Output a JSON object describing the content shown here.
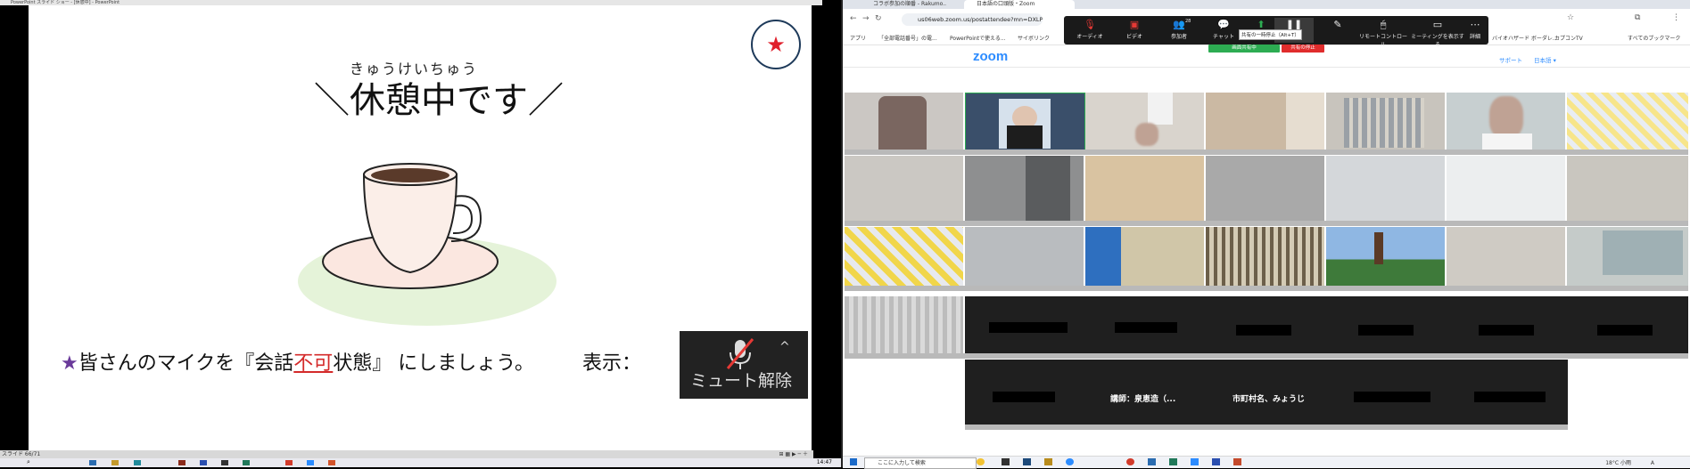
{
  "ppt": {
    "title_bar": "PowerPoint スライド ショー - [休憩中] - PowerPoint",
    "slide": {
      "ruby": "きゅうけいちゅう",
      "title": "＼休憩中です／",
      "star_badge": "★",
      "instruction_star": "★",
      "instruction_pre": "皆さんのマイクを『会話",
      "instruction_red": "不可",
      "instruction_post": "状態』 にしましょう。",
      "display_label": "表示：",
      "mute_button_label": "ミュート解除",
      "mute_caret": "^"
    },
    "status_bar": {
      "slide_number": "スライド 66/71",
      "time": "14:47"
    }
  },
  "chrome": {
    "tabs": [
      {
        "label": "コラボ参加の順番 - Rakumo.."
      },
      {
        "label": "日本語の口頭版・Zoom"
      }
    ],
    "url": "us06web.zoom.us/postattendee?mn=DXLP...",
    "bookmarks": [
      {
        "label": "アプリ"
      },
      {
        "label": "「全部電話番号」の電..."
      },
      {
        "label": "PowerPointで使える..."
      },
      {
        "label": "サイボリンク"
      },
      {
        "label": "バイオハザード ボーダレ..."
      },
      {
        "label": "カプコンTV"
      },
      {
        "label": "すべてのブックマーク"
      }
    ]
  },
  "zoom": {
    "logo": "zoom",
    "nav_support": "サポート",
    "nav_language": "日本語 ▾",
    "toolbar": [
      {
        "icon": "mic-muted-icon",
        "label": "オーディオ"
      },
      {
        "icon": "video-muted-icon",
        "label": "ビデオ"
      },
      {
        "icon": "participants-icon",
        "label": "参加者",
        "badge": "28"
      },
      {
        "icon": "chat-icon",
        "label": "チャット"
      },
      {
        "icon": "share-icon",
        "label": "共有"
      },
      {
        "icon": "pause-share-icon",
        "label": "共有の一時停止"
      },
      {
        "icon": "annotate-icon",
        "label": "注釈"
      },
      {
        "icon": "remote-control-icon",
        "label": "リモートコントロール"
      },
      {
        "icon": "show-meeting-icon",
        "label": "ミーティングを表示する"
      },
      {
        "icon": "more-icon",
        "label": "詳細"
      }
    ],
    "tooltip": "共有の一時停止（Alt+T）",
    "sharing_indicator": "画面共有中",
    "stop_share": "共有の停止",
    "participant_names": [
      "講師：泉恵造（...",
      "市町村名、みょうじ"
    ]
  },
  "windows": {
    "search_placeholder": "ここに入力して検索",
    "weather": "18°C 小雨",
    "ime": "A"
  },
  "colors": {
    "zoom_blue": "#2d8cff",
    "share_green": "#2dac52",
    "stop_red": "#e02c2c",
    "star_red": "#e0202c",
    "star_purple": "#6a3a9a"
  }
}
